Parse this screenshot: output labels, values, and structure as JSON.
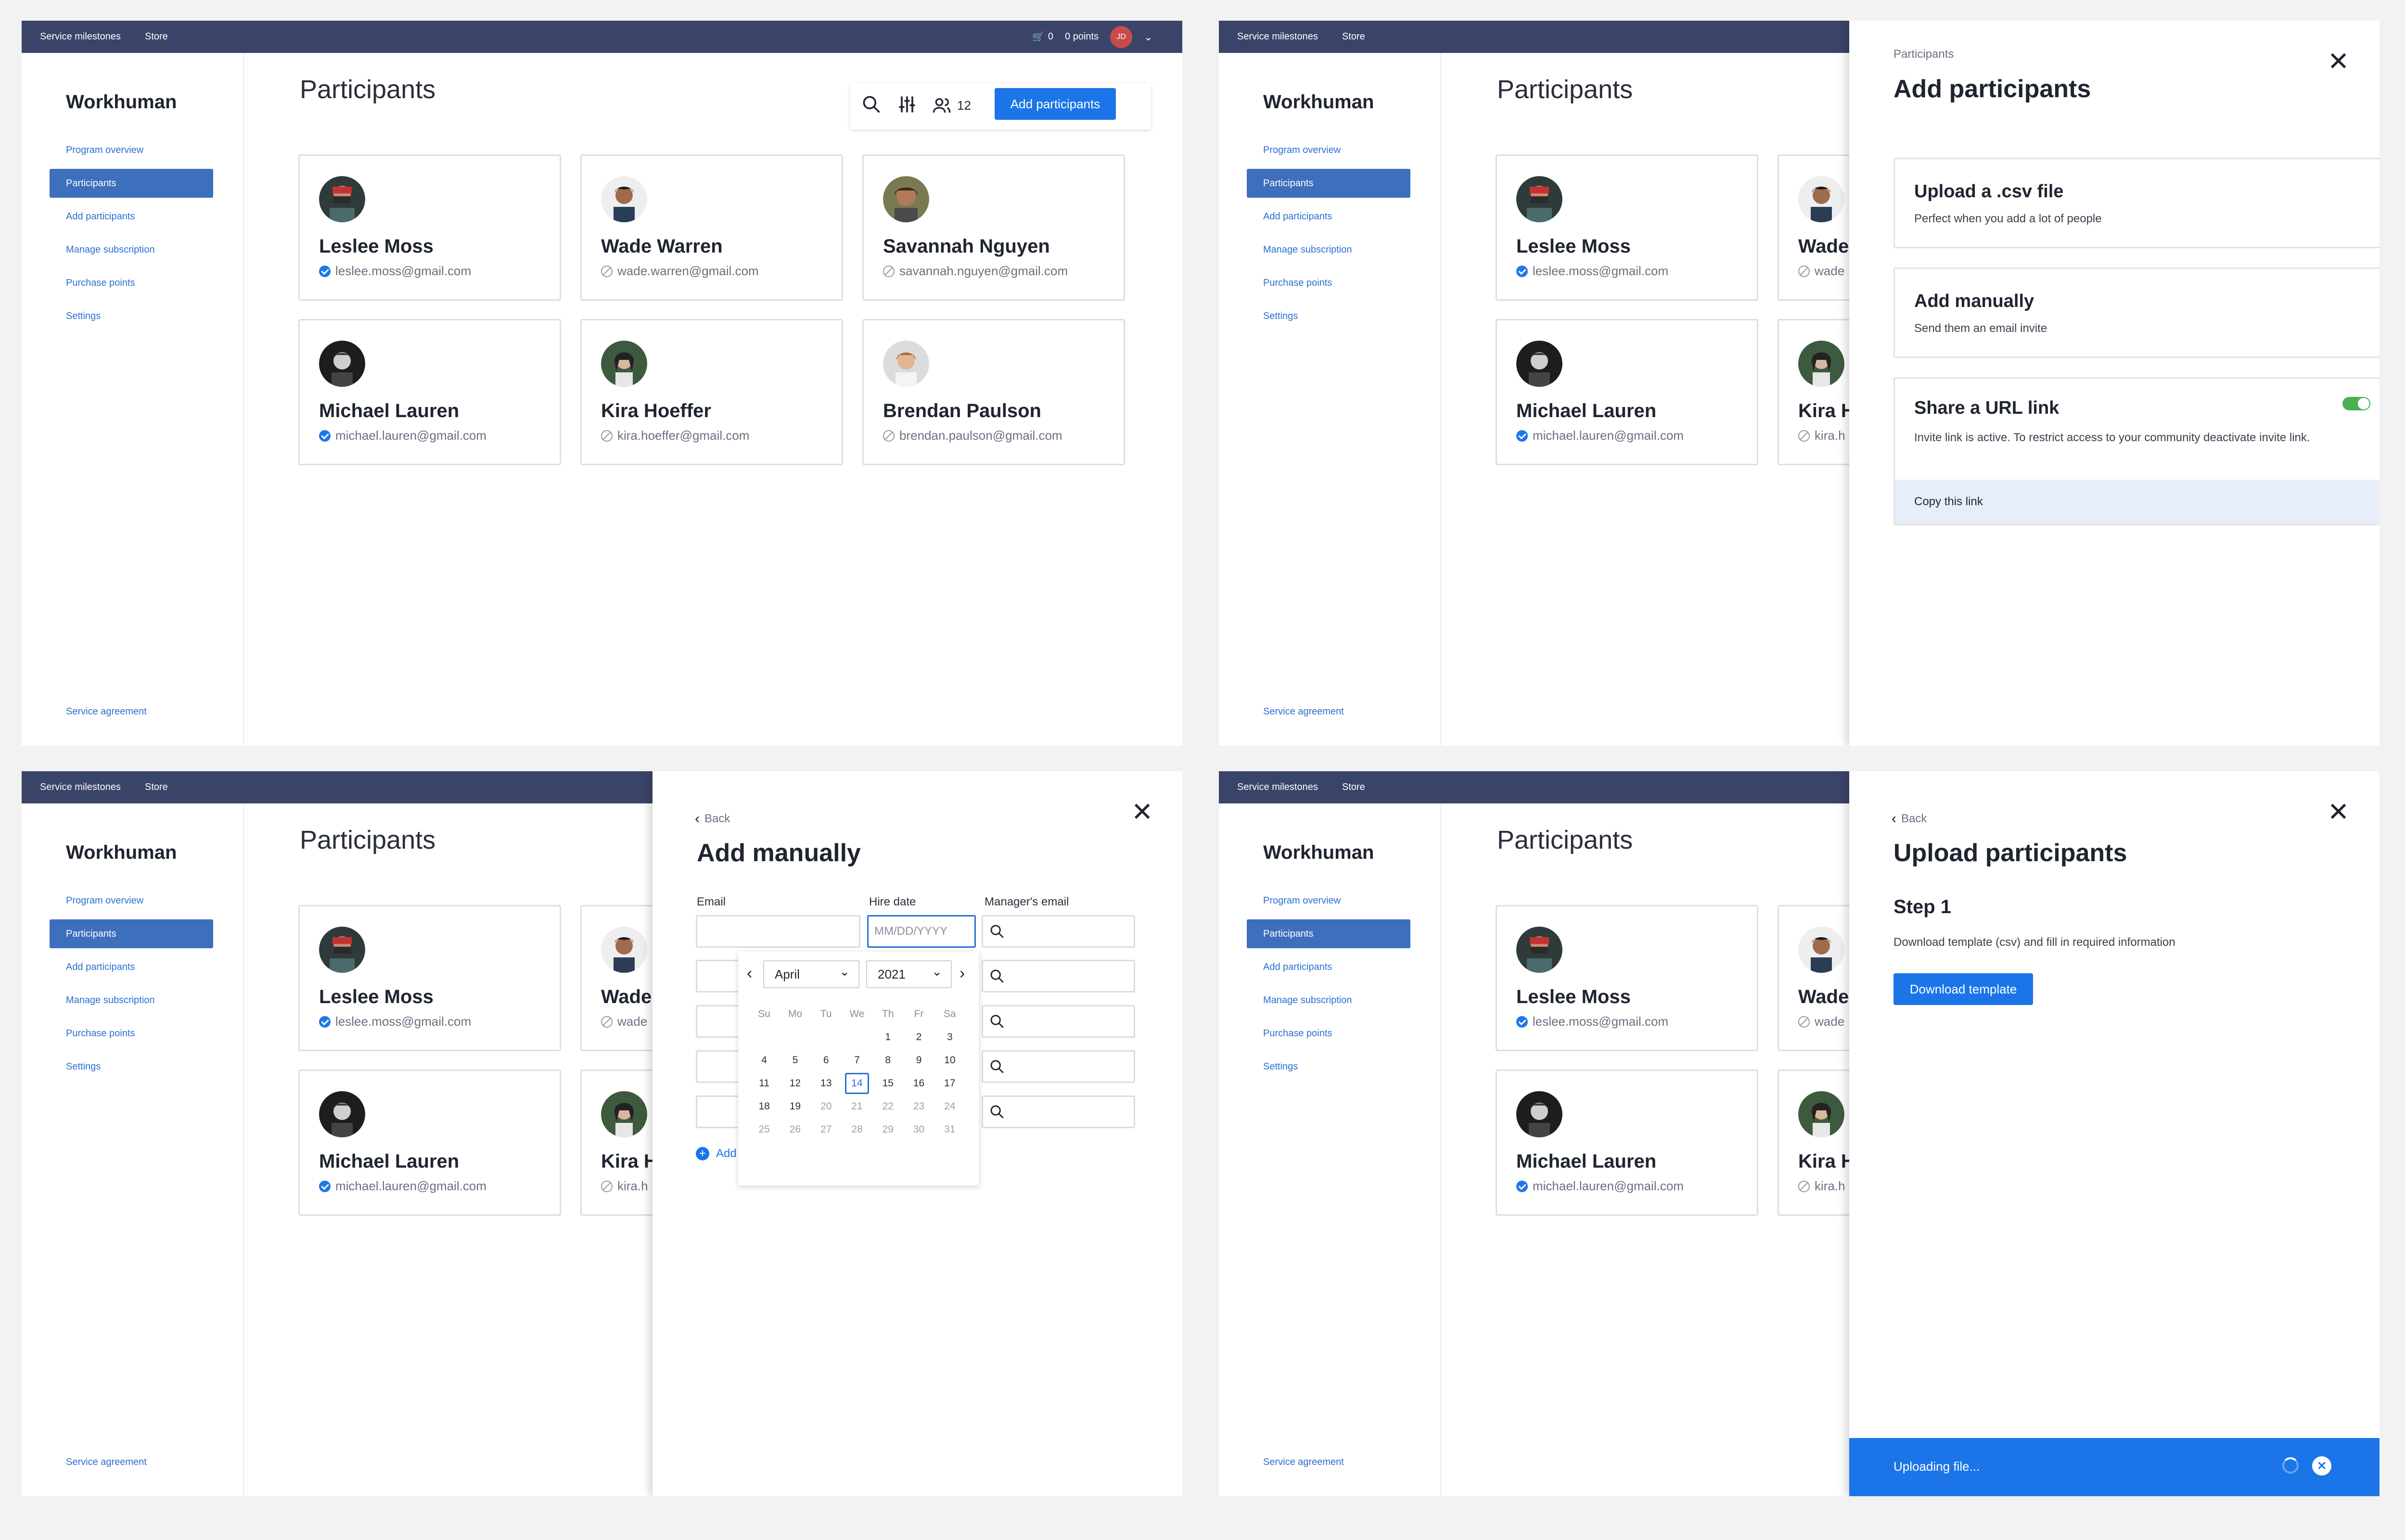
{
  "topbar": {
    "links": [
      "Service milestones",
      "Store"
    ],
    "cart_count": "0",
    "points": "0 points",
    "avatar": "JD"
  },
  "brand": "Workhuman",
  "nav": [
    "Program overview",
    "Participants",
    "Add participants",
    "Manage subscription",
    "Purchase points",
    "Settings"
  ],
  "service_agreement": "Service agreement",
  "page_title": "Participants",
  "participant_count": "12",
  "add_participants_button": "Add participants",
  "participants": [
    {
      "name": "Leslee Moss",
      "email": "leslee.moss@gmail.com",
      "status": "verified"
    },
    {
      "name": "Wade Warren",
      "email": "wade.warren@gmail.com",
      "status": "pending"
    },
    {
      "name": "Savannah Nguyen",
      "email": "savannah.nguyen@gmail.com",
      "status": "blocked"
    },
    {
      "name": "Michael Lauren",
      "email": "michael.lauren@gmail.com",
      "status": "verified"
    },
    {
      "name": "Kira Hoeffer",
      "email": "kira.hoeffer@gmail.com",
      "status": "pending"
    },
    {
      "name": "Brendan Paulson",
      "email": "brendan.paulson@gmail.com",
      "status": "blocked"
    }
  ],
  "truncated": {
    "wade": "Wade",
    "kira_h": "Kira H",
    "wade_email": "wade",
    "kira_email": "kira.h"
  },
  "add_panel": {
    "breadcrumb": "Participants",
    "title": "Add participants",
    "csv_title": "Upload a .csv file",
    "csv_desc": "Perfect when you add a lot  of people",
    "manual_title": "Add manually",
    "manual_desc": "Send them an email invite",
    "url_title": "Share a URL link",
    "url_desc": "Invite link is active. To restrict access to your community deactivate invite link.",
    "url_toggle": "on",
    "copy_link": "Copy this link"
  },
  "manual_panel": {
    "back": "Back",
    "title": "Add manually",
    "email_label": "Email",
    "hire_label": "Hire date",
    "manager_label": "Manager's email",
    "date_placeholder": "MM/DD/YYYY",
    "add_row": "Add",
    "calendar": {
      "month": "April",
      "year": "2021",
      "weekdays": [
        "Su",
        "Mo",
        "Tu",
        "We",
        "Th",
        "Fr",
        "Sa"
      ],
      "weeks": [
        [
          "",
          "",
          "",
          "",
          "1",
          "2",
          "3"
        ],
        [
          "4",
          "5",
          "6",
          "7",
          "8",
          "9",
          "10"
        ],
        [
          "11",
          "12",
          "13",
          "14",
          "15",
          "16",
          "17"
        ],
        [
          "18",
          "19",
          "20",
          "21",
          "22",
          "23",
          "24"
        ],
        [
          "25",
          "26",
          "27",
          "28",
          "29",
          "30",
          "31"
        ]
      ],
      "selected_day": "14"
    }
  },
  "upload_panel": {
    "back": "Back",
    "title": "Upload participants",
    "step": "Step 1",
    "step_desc": "Download template (csv) and fill in required information",
    "download_button": "Download template",
    "status": "Uploading file..."
  },
  "colors": {
    "topbar": "#3a4468",
    "accent": "#1b75e8",
    "nav_active": "#3d6fbd",
    "toggle": "#4caf50",
    "upload_bar": "#1b75e8"
  }
}
